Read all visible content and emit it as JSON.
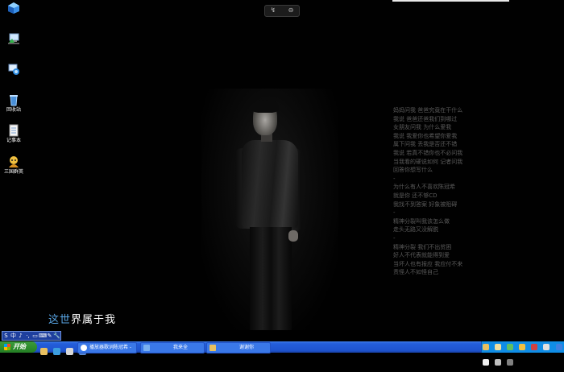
{
  "desktop": {
    "icons": [
      {
        "name": "computer-icon",
        "label": ""
      },
      {
        "name": "network-icon",
        "label": ""
      },
      {
        "name": "ie-icon",
        "label": ""
      },
      {
        "name": "recycle-bin-icon",
        "label": "回收站"
      },
      {
        "name": "notepad-icon",
        "label": "记事本"
      },
      {
        "name": "game-icon",
        "label": "三国群英"
      }
    ],
    "topbar": {
      "left": "↯",
      "right": "⊖"
    }
  },
  "lyrics": [
    "妈妈问我 爸爸究竟在干什么",
    "我说 爸爸还爸我们到哪过",
    "女朋友问我 为什么爱我",
    "我说 我爱你也希望你爱我",
    "属下问我 丢我是否还不错",
    "我说 若真不错你也不必问我",
    "当我看的硬说如何 记者问我",
    "回答你想写什么",
    "-",
    "为什么有人不喜欢陈冠希",
    "就是你 还不够CD",
    "我找不到答案 好象被阻碍",
    "-",
    "精神分裂叫我该怎么做",
    "走头无路又没解脱",
    "-",
    "精神分裂 我们不出贫困",
    "好人不代表就能得到爱",
    "当坏人也有报应 我应付不来",
    "责怪人不如怪自己"
  ],
  "lyric_display": {
    "highlight": "这世",
    "rest": "界属于我"
  },
  "language_bar": [
    "S",
    "中",
    "♪",
    "·,",
    "▭",
    "⌨",
    "✎",
    "🔧"
  ],
  "taskbar": {
    "start_label": "开始",
    "tasks": [
      {
        "label": "播放器歌词",
        "left": "陈冠希 - "
      },
      {
        "label": "我来全"
      },
      {
        "label": "谢谢你"
      }
    ]
  },
  "colors": {
    "taskbar": "#245edb",
    "start_button": "#2f8f2f",
    "tray": "#0f8de6",
    "lyric_highlight": "#5aa8e8",
    "lyric_text": "#5a5a5a"
  }
}
